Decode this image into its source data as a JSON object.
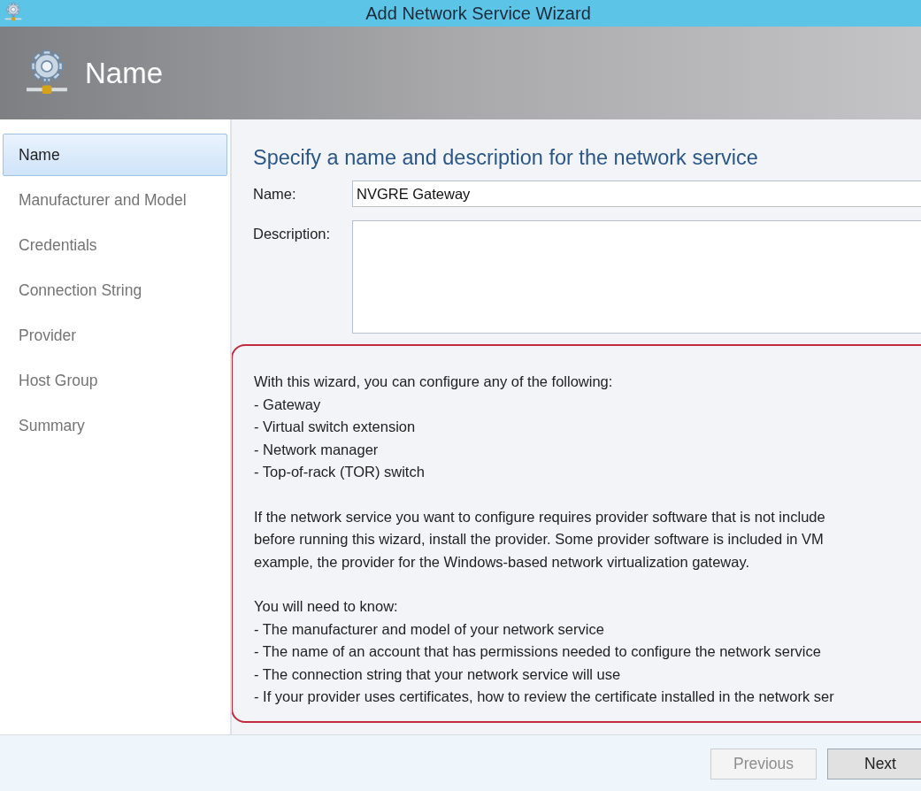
{
  "window": {
    "title": "Add Network Service Wizard"
  },
  "header": {
    "title": "Name"
  },
  "steps": [
    {
      "label": "Name",
      "selected": true
    },
    {
      "label": "Manufacturer and Model",
      "selected": false
    },
    {
      "label": "Credentials",
      "selected": false
    },
    {
      "label": "Connection String",
      "selected": false
    },
    {
      "label": "Provider",
      "selected": false
    },
    {
      "label": "Host Group",
      "selected": false
    },
    {
      "label": "Summary",
      "selected": false
    }
  ],
  "page": {
    "heading": "Specify a name and description for the network service",
    "fields": [
      {
        "label": "Name:",
        "value": "NVGRE Gateway",
        "kind": "line"
      },
      {
        "label": "Description:",
        "kind": "multiline"
      }
    ]
  },
  "info": [
    {
      "intro": "With this wizard, you can configure any of the following:",
      "items": [
        "- Gateway",
        "- Virtual switch extension",
        "- Network manager",
        "- Top-of-rack (TOR) switch"
      ]
    },
    {
      "lines": [
        "If the network service you want to configure requires provider software that is not include",
        "before running this wizard, install the provider. Some provider software is included in VM",
        "example, the provider for the Windows-based network virtualization gateway."
      ]
    },
    {
      "intro": "You will need to know:",
      "items": [
        "- The manufacturer and model of your network service",
        "- The name of an account that has permissions needed to configure the network service",
        "- The connection string that your network service will use",
        "- If your provider uses certificates, how to review the certificate installed in the network ser"
      ]
    }
  ],
  "buttons": [
    {
      "label": "Previous",
      "disabled": true
    },
    {
      "label": "Next",
      "disabled": false
    }
  ]
}
